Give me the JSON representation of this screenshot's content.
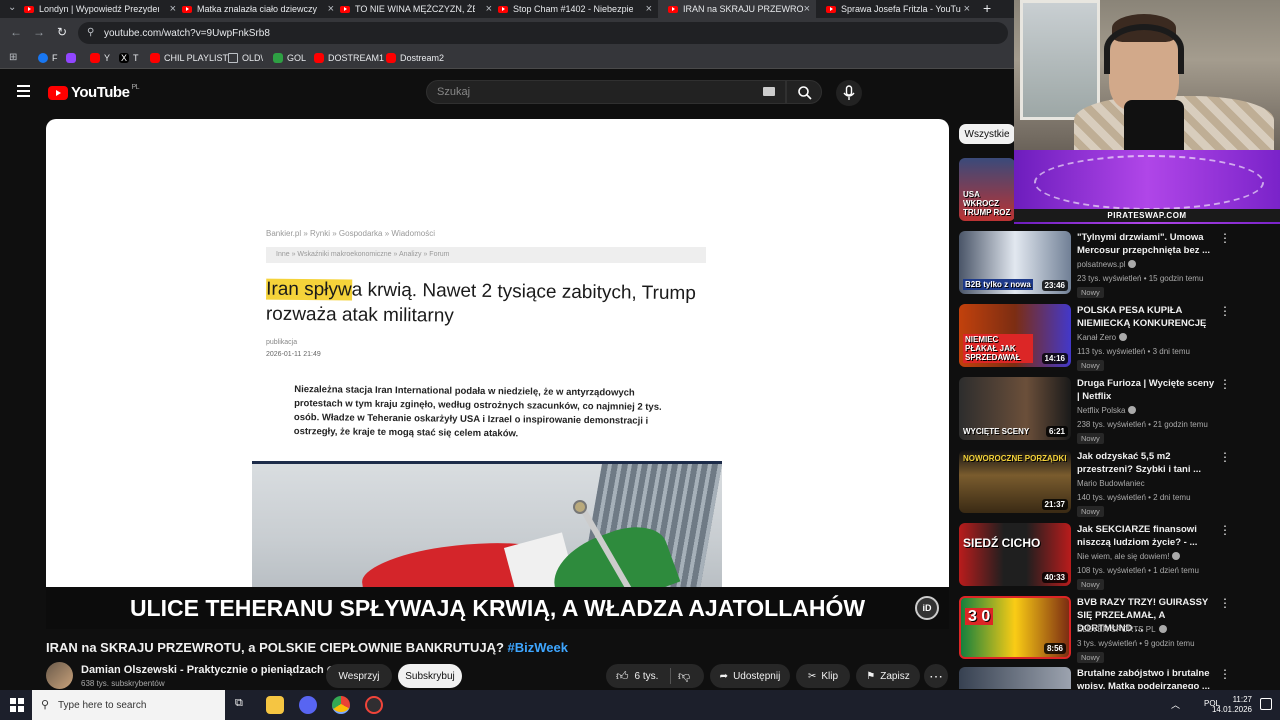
{
  "browser": {
    "tabs": [
      {
        "label": "Londyn | Wypowiedź Prezydent"
      },
      {
        "label": "Matka znalazła ciało dziewczyn"
      },
      {
        "label": "TO NIE WINA MĘŻCZYZN, ŻE P"
      },
      {
        "label": "Stop Cham #1402 - Niebezpiec"
      },
      {
        "label": "IRAN na SKRAJU PRZEWROTU,"
      },
      {
        "label": "Sprawa Josefa Fritzla - YouTube"
      }
    ],
    "url": "youtube.com/watch?v=9UwpFnkSrb8",
    "bookmarks": [
      {
        "label": "F"
      },
      {
        "label": "Y"
      },
      {
        "label": "T"
      },
      {
        "label": "CHIL PLAYLIST"
      },
      {
        "label": "OLD\\"
      },
      {
        "label": "GOL"
      },
      {
        "label": "DOSTREAM1"
      },
      {
        "label": "Dostream2"
      }
    ]
  },
  "youtube": {
    "logo_text": "YouTube",
    "logo_country": "PL",
    "search_placeholder": "Szukaj"
  },
  "video_frame": {
    "breadcrumb_1": "Bankier.pl  »  Rynki  »  Gospodarka  »  Wiadomości",
    "breadcrumb_2": "Inne  »  Wskaźniki makroekonomiczne  »  Analizy  »  Forum",
    "headline_highlight": "Iran spływ",
    "headline_rest": "a krwią. Nawet 2 tysiące zabitych, Trump rozważa atak militarny",
    "pub_label": "publikacja",
    "pub_date": "2026-01-11 21:49",
    "lead": "Niezależna stacja Iran International podała w niedzielę, że w antyrządowych protestach w tym kraju zginęło, według ostrożnych szacunków, co najmniej 2 tys. osób. Władze w Teheranie oskarżyły USA i Izrael o inspirowanie demonstracji i ostrzegły, że kraje te mogą stać się celem ataków.",
    "caption": "ULICE TEHERANU SPŁYWAJĄ KRWIĄ, A WŁADZA AJATOLLAHÓW",
    "caption_icon": "iD"
  },
  "video": {
    "title_main": "IRAN na SKRAJU PRZEWROTU, a POLSKIE CIEPŁOWNIE BANKRUTUJĄ?",
    "title_tag": "#BizWeek",
    "channel_name": "Damian Olszewski - Praktycznie o pieniądzach",
    "channel_subs": "638 tys. subskrybentów",
    "support_label": "Wesprzyj",
    "subscribe_label": "Subskrybuj",
    "likes": "6 tys.",
    "share_label": "Udostępnij",
    "clip_label": "Klip",
    "save_label": "Zapisz"
  },
  "sidebar": {
    "chip": "Wszystkie",
    "first_thumb_text": "USA WKROCZ TRUMP ROZ",
    "items": [
      {
        "title": "\"Tylnymi drzwiami\". Umowa Mercosur przepchnięta bez ...",
        "channel": "polsatnews.pl",
        "meta": "23 tys. wyświetleń • 15 godzin temu",
        "badge": "Nowy",
        "duration": "23:46",
        "thumb_text": "B2B tylko z nowa"
      },
      {
        "title": "POLSKA PESA KUPIŁA NIEMIECKĄ KONKURENCJĘ",
        "channel": "Kanał Zero",
        "meta": "113 tys. wyświetleń • 3 dni temu",
        "badge": "Nowy",
        "duration": "14:16",
        "thumb_text": "NIEMIEC PŁAKAŁ JAK SPRZEDAWAŁ"
      },
      {
        "title": "Druga Furioza | Wycięte sceny | Netflix",
        "channel": "Netflix Polska",
        "meta": "238 tys. wyświetleń • 21 godzin temu",
        "badge": "Nowy",
        "duration": "6:21",
        "thumb_text": "WYCIĘTE SCENY"
      },
      {
        "title": "Jak odzyskać 5,5 m2 przestrzeni? Szybki i tani ...",
        "channel": "Mario Budowlaniec",
        "meta": "140 tys. wyświetleń • 2 dni temu",
        "badge": "Nowy",
        "duration": "21:37",
        "thumb_text": "NOWOROCZNE PORZĄDKI"
      },
      {
        "title": "Jak SEKCIARZE finansowi niszczą ludziom życie? - ...",
        "channel": "Nie wiem, ale się dowiem!",
        "meta": "108 tys. wyświetleń • 1 dzień temu",
        "badge": "Nowy",
        "duration": "40:33",
        "thumb_text": "SIEDŹ CICHO"
      },
      {
        "title": "BVB RAZY TRZY! GUIRASSY SIĘ PRZEŁAMAŁ, A DORTMUND ...",
        "channel": "ELEVEN SPORTS PL",
        "meta": "3 tys. wyświetleń • 9 godzin temu",
        "badge": "Nowy",
        "duration": "8:56",
        "thumb_text": "3 0"
      },
      {
        "title": "Brutalne zabójstwo i brutalne wpisy. Matka podejrzanego ...",
        "channel": "",
        "meta": "",
        "badge": "",
        "duration": "",
        "thumb_text": ""
      }
    ]
  },
  "overlay": {
    "promo_text": "PIRATESWAP.COM"
  },
  "taskbar": {
    "search_placeholder": "Type here to search",
    "lang": "POL",
    "time": "11:27",
    "date": "14.01.2026"
  },
  "colors": {
    "yt_red": "#ff0000",
    "link_blue": "#3ea6ff",
    "highlight": "#f5d33a",
    "promo_purple": "#b046e8"
  }
}
